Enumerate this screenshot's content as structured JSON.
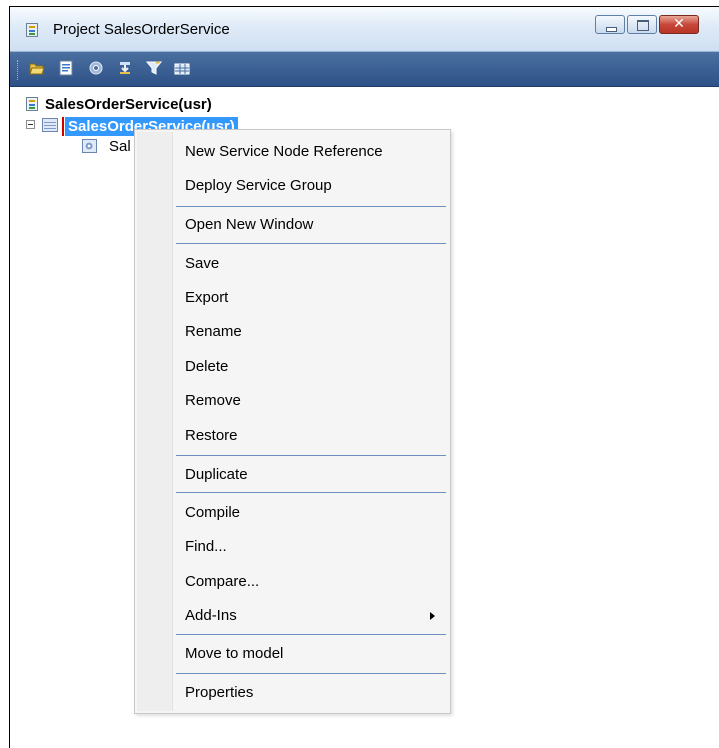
{
  "window": {
    "title": "Project SalesOrderService",
    "controls": [
      "minimize",
      "maximize",
      "close"
    ],
    "close_color": "#c7483a"
  },
  "toolbar": {
    "buttons": [
      "open-folder-icon",
      "properties-icon",
      "settings-icon",
      "import-icon",
      "filter-icon",
      "grid-icon"
    ]
  },
  "tree": {
    "root_label": "SalesOrderService(usr)",
    "selected_label": "SalesOrderService(usr)",
    "grandchild_label": "Sal",
    "selection_color": "#3399ff"
  },
  "context_menu": {
    "items": [
      {
        "label": "New Service Node Reference"
      },
      {
        "label": "Deploy Service Group"
      },
      {
        "label": "Open New Window"
      },
      {
        "label": "Save"
      },
      {
        "label": "Export"
      },
      {
        "label": "Rename"
      },
      {
        "label": "Delete"
      },
      {
        "label": "Remove"
      },
      {
        "label": "Restore"
      },
      {
        "label": "Duplicate"
      },
      {
        "label": "Compile"
      },
      {
        "label": "Find..."
      },
      {
        "label": "Compare..."
      },
      {
        "label": "Add-Ins",
        "has_submenu": true
      },
      {
        "label": "Move to model"
      },
      {
        "label": "Properties"
      }
    ]
  }
}
